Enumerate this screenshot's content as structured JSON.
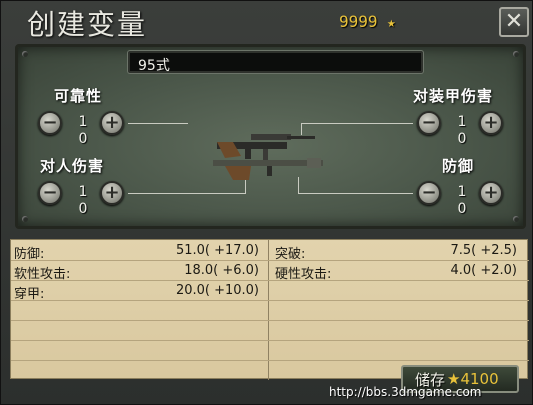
{
  "header": {
    "title": "创建变量",
    "points": "9999",
    "points_icon": "star-icon",
    "close_icon": "close-icon"
  },
  "design": {
    "variant_name": "95式",
    "stats": [
      {
        "label": "可靠性",
        "level": "1",
        "change": "0"
      },
      {
        "label": "对装甲伤害",
        "level": "1",
        "change": "0"
      },
      {
        "label": "对人伤害",
        "level": "1",
        "change": "0"
      },
      {
        "label": "防御",
        "level": "1",
        "change": "0"
      }
    ],
    "minus_icon": "minus-icon",
    "plus_icon": "plus-icon",
    "weapon_icon": "infantry-weapon-icon"
  },
  "stats_sheet": {
    "left": [
      {
        "name": "防御:",
        "value": "51.0( +17.0)"
      },
      {
        "name": "软性攻击:",
        "value": "18.0( +6.0)"
      },
      {
        "name": "穿甲:",
        "value": "20.0( +10.0)"
      }
    ],
    "right": [
      {
        "name": "突破:",
        "value": "7.5( +2.5)"
      },
      {
        "name": "硬性攻击:",
        "value": "4.0( +2.0)"
      }
    ]
  },
  "save": {
    "label": "储存",
    "cost": "★4100"
  },
  "watermark": "http://bbs.3dmgame.com",
  "colors": {
    "accent_gold": "#e8c23a",
    "panel_green": "#4a5649",
    "parchment": "#dccb a2"
  }
}
